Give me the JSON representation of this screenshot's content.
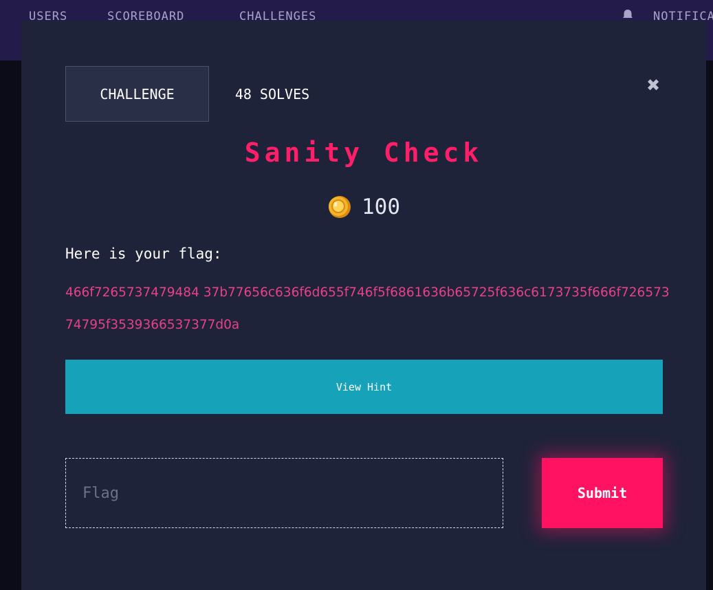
{
  "nav": {
    "items": [
      "USERS",
      "SCOREBOARD",
      "CHALLENGES"
    ],
    "notifications_label": "NOTIFICATIONS"
  },
  "modal": {
    "tabs": [
      "CHALLENGE",
      "48 SOLVES"
    ],
    "close_icon": "close-icon",
    "title": "Sanity Check",
    "value_icon": "coin-icon",
    "value": "100",
    "description": "Here is your flag:",
    "flag_text": "466f7265737479484 37b77656c636f6d655f746f5f6861636b65725f636c6173735f666f72657374795f3539366537377d0a",
    "hint_button": "View Hint",
    "flag_input": {
      "placeholder": "Flag",
      "value": ""
    },
    "submit_button": "Submit"
  },
  "colors": {
    "accent_pink": "#ff1262",
    "hint_teal": "#16a2b8",
    "flag_text": "#e8408a",
    "modal_bg": "#1e233a",
    "topbar_bg": "#231c4a"
  }
}
